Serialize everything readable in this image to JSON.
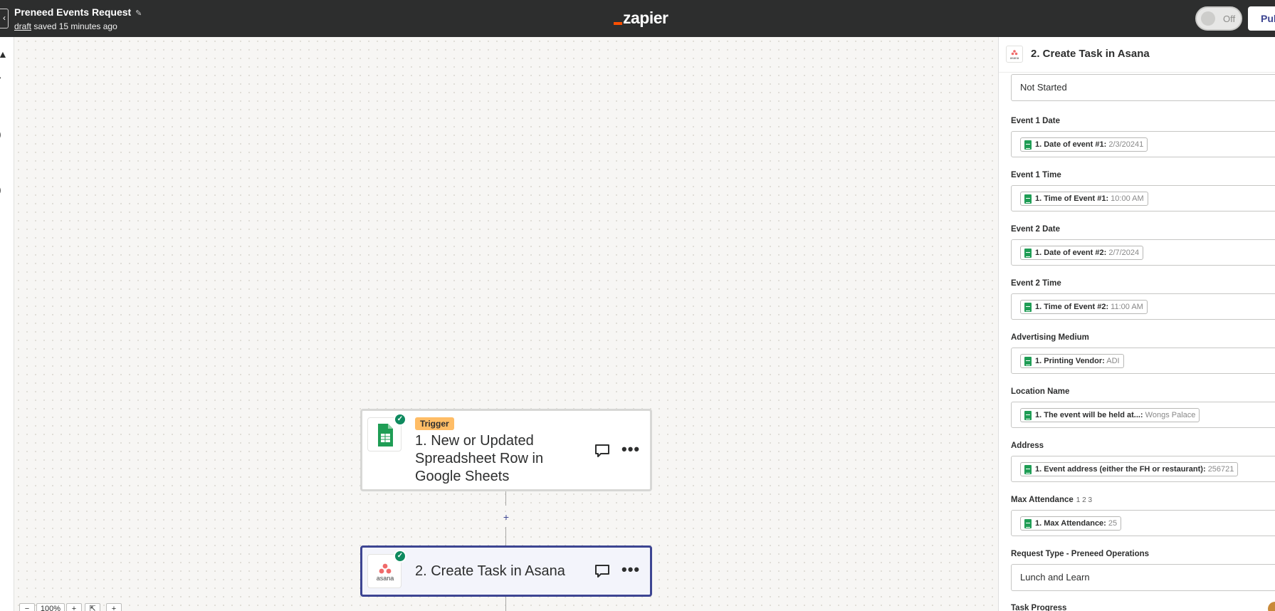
{
  "header": {
    "zap_title": "Preneed Events Request",
    "draft_link": "draft",
    "saved_text": "saved 15 minutes ago",
    "logo_text": "zapier",
    "toggle_label": "Off",
    "publish_label": "Pub"
  },
  "canvas": {
    "steps": [
      {
        "badge": "Trigger",
        "title": "1. New or Updated Spreadsheet Row in Google Sheets",
        "app_icon": "google-sheets-icon",
        "status": "complete"
      },
      {
        "title": "2. Create Task in Asana",
        "app_icon": "asana-icon",
        "status": "complete",
        "selected": true
      }
    ],
    "zoom_level": "100%"
  },
  "panel": {
    "title": "2. Create Task in Asana",
    "app_icon_label": "asana",
    "status_value": "Not Started",
    "fields": [
      {
        "label": "Event 1 Date",
        "pill_key": "1. Date of event #1:",
        "pill_value": "2/3/20241"
      },
      {
        "label": "Event 1 Time",
        "pill_key": "1. Time of Event #1:",
        "pill_value": "10:00 AM"
      },
      {
        "label": "Event 2 Date",
        "pill_key": "1. Date of event #2:",
        "pill_value": "2/7/2024"
      },
      {
        "label": "Event 2 Time",
        "pill_key": "1. Time of Event #2:",
        "pill_value": "11:00 AM"
      },
      {
        "label": "Advertising Medium",
        "pill_key": "1. Printing Vendor:",
        "pill_value": "ADI"
      },
      {
        "label": "Location Name",
        "pill_key": "1. The event will be held at...:",
        "pill_value": "Wongs Palace"
      },
      {
        "label": "Address",
        "pill_key": "1. Event address (either the FH or restaurant):",
        "pill_value": "256721"
      },
      {
        "label": "Max Attendance",
        "hint": "1 2 3",
        "pill_key": "1. Max Attendance:",
        "pill_value": "25"
      }
    ],
    "request_type_label": "Request Type - Preneed Operations",
    "request_type_value": "Lunch and Learn",
    "next_label": "Task Progress"
  },
  "colors": {
    "header_bg": "#2d2e2e",
    "zapier_orange": "#ff4f00",
    "selected_border": "#3d4592",
    "success_green": "#0f8a5f",
    "trigger_badge": "#ffbd66"
  }
}
